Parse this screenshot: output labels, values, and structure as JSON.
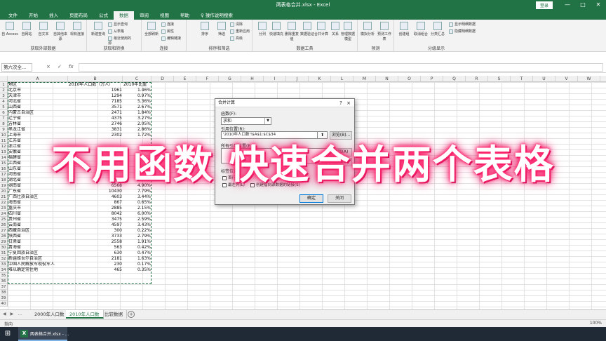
{
  "window": {
    "title": "两表格合并.xlsx  -  Excel",
    "login": "登录"
  },
  "tabs": [
    "文件",
    "开始",
    "插入",
    "页面布局",
    "公式",
    "数据",
    "审阅",
    "视图",
    "帮助"
  ],
  "active_tab": "数据",
  "search_hint": "操作说明搜索",
  "ribbon": {
    "groups": [
      {
        "label": "获取外部数据",
        "items": [
          "自 Access",
          "自网站",
          "自文本",
          "自其他来源",
          "现有连接"
        ]
      },
      {
        "label": "获取和转换",
        "items": [
          "新建查询",
          "显示查询",
          "从表格",
          "最近使用的源"
        ]
      },
      {
        "label": "连接",
        "items": [
          "全部刷新",
          "连接",
          "属性",
          "编辑链接"
        ]
      },
      {
        "label": "排序和筛选",
        "items": [
          "排序",
          "筛选",
          "清除",
          "重新应用",
          "高级"
        ]
      },
      {
        "label": "数据工具",
        "items": [
          "分列",
          "快速填充",
          "删除重复值",
          "数据验证",
          "合并计算",
          "关系",
          "管理数据模型"
        ]
      },
      {
        "label": "预测",
        "items": [
          "模拟分析",
          "预测工作表"
        ]
      },
      {
        "label": "分级显示",
        "items": [
          "创建组",
          "取消组合",
          "分类汇总",
          "显示明细数据",
          "隐藏明细数据"
        ]
      }
    ]
  },
  "formula_bar": {
    "name_box": "第六次全...",
    "cancel": "×",
    "confirm": "✓",
    "fx": "fx",
    "value": ""
  },
  "columns": [
    "A",
    "B",
    "C",
    "D",
    "E",
    "F",
    "G",
    "H",
    "I",
    "J",
    "K",
    "L",
    "M",
    "N",
    "O",
    "P",
    "Q",
    "R",
    "S",
    "T",
    "U",
    "V",
    "W",
    "X",
    "Y",
    "Z",
    "AA"
  ],
  "rows": [
    [
      "地区",
      "2010年人口数（万人）",
      "2010年比重"
    ],
    [
      "北京市",
      "1961",
      "1.46%"
    ],
    [
      "天津市",
      "1294",
      "0.97%"
    ],
    [
      "河北省",
      "7185",
      "5.36%"
    ],
    [
      "山西省",
      "3571",
      "2.67%"
    ],
    [
      "内蒙古自治区",
      "2471",
      "1.84%"
    ],
    [
      "辽宁省",
      "4375",
      "3.27%"
    ],
    [
      "吉林省",
      "2746",
      "2.05%"
    ],
    [
      "黑龙江省",
      "3831",
      "2.86%"
    ],
    [
      "上海市",
      "2302",
      "1.72%"
    ],
    [
      "江苏省",
      "",
      ""
    ],
    [
      "浙江省",
      "",
      ""
    ],
    [
      "安徽省",
      "",
      ""
    ],
    [
      "福建省",
      "",
      ""
    ],
    [
      "江西省",
      "",
      ""
    ],
    [
      "山东省",
      "",
      ""
    ],
    [
      "河南省",
      "",
      ""
    ],
    [
      "湖北省",
      "5724",
      "4.27%"
    ],
    [
      "湖南省",
      "6568",
      "4.90%"
    ],
    [
      "广东省",
      "10430",
      "7.79%"
    ],
    [
      "广西壮族自治区",
      "4603",
      "3.44%"
    ],
    [
      "海南省",
      "867",
      "0.65%"
    ],
    [
      "重庆市",
      "2885",
      "2.15%"
    ],
    [
      "四川省",
      "8042",
      "6.00%"
    ],
    [
      "贵州省",
      "3475",
      "2.59%"
    ],
    [
      "云南省",
      "4597",
      "3.43%"
    ],
    [
      "西藏自治区",
      "300",
      "0.22%"
    ],
    [
      "陕西省",
      "3733",
      "2.79%"
    ],
    [
      "甘肃省",
      "2558",
      "1.91%"
    ],
    [
      "青海省",
      "563",
      "0.42%"
    ],
    [
      "宁夏回族自治区",
      "630",
      "0.47%"
    ],
    [
      "新疆维吾尔自治区",
      "2181",
      "1.63%"
    ],
    [
      "中国人民解放军现役军人",
      "230",
      "0.17%"
    ],
    [
      "难以确定常住地",
      "465",
      "0.35%"
    ],
    [
      "",
      "",
      ""
    ],
    [
      "",
      "",
      ""
    ],
    [
      "",
      "",
      ""
    ],
    [
      "",
      "",
      ""
    ],
    [
      "",
      "",
      ""
    ],
    [
      "",
      "",
      ""
    ]
  ],
  "dialog": {
    "title": "合并计算",
    "help": "?",
    "close": "×",
    "function_label": "函数(F):",
    "function_value": "求和",
    "ref_label": "引用位置(R):",
    "ref_value": "'2010年人口数'!$A$1:$C$34",
    "browse": "浏览(B)...",
    "all_refs_label": "所有引用位置(E):",
    "add": "添加(A)",
    "delete": "删除(D)",
    "label_pos": "标签位置",
    "first_row": "首行(T)",
    "left_col": "最左列(L)",
    "create_links": "创建指向源数据的链接(S)",
    "ok": "确定",
    "close_btn": "关闭"
  },
  "caption": "不用函数 快速合并两个表格",
  "sheets": [
    "2000年人口数",
    "2010年人口数",
    "比较数据"
  ],
  "active_sheet": "2010年人口数",
  "status": {
    "mode": "指向",
    "zoom": "100%"
  },
  "taskbar": {
    "app_label": "两表格合并.xlsx - ...",
    "time": "",
    "date": ""
  }
}
